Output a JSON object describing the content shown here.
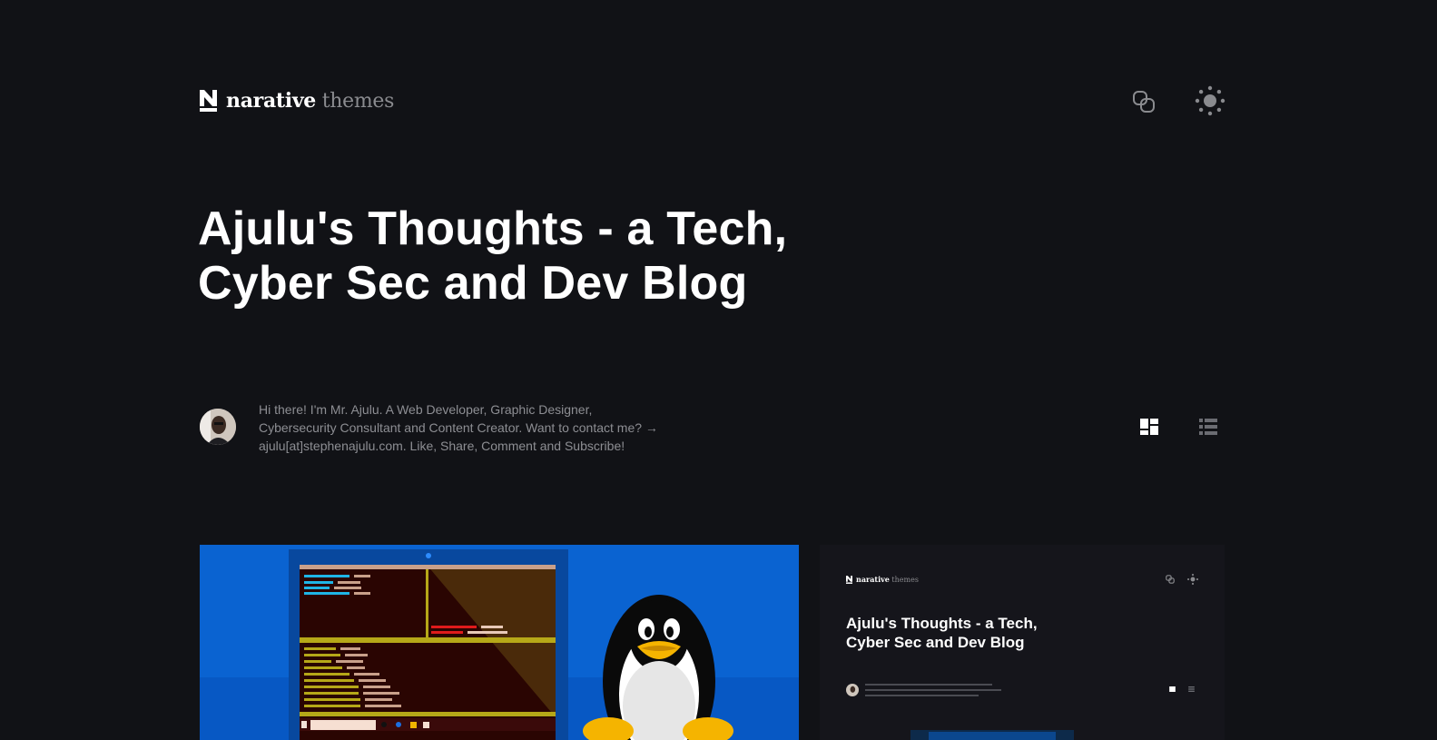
{
  "header": {
    "logo_primary": "narative",
    "logo_secondary": "themes"
  },
  "hero": {
    "title": "Ajulu's Thoughts - a Tech, Cyber Sec and Dev Blog",
    "bio": "Hi there! I'm Mr. Ajulu. A Web Developer, Graphic Designer, Cybersecurity Consultant and Content Creator. Want to contact me? → ajulu[at]stephenajulu.com. Like, Share, Comment and Subscribe!"
  },
  "preview": {
    "logo_primary": "narative",
    "logo_secondary": "themes",
    "title": "Ajulu's Thoughts - a Tech, Cyber Sec and Dev Blog"
  },
  "icons": {
    "logo": "narative-logo-icon",
    "copy": "link-icon",
    "theme": "sun-icon",
    "grid": "grid-layout-icon",
    "list": "list-layout-icon"
  },
  "colors": {
    "background": "#111216",
    "text": "#ffffff",
    "muted": "#8d8e93",
    "card_blue": "#0a63d1"
  }
}
